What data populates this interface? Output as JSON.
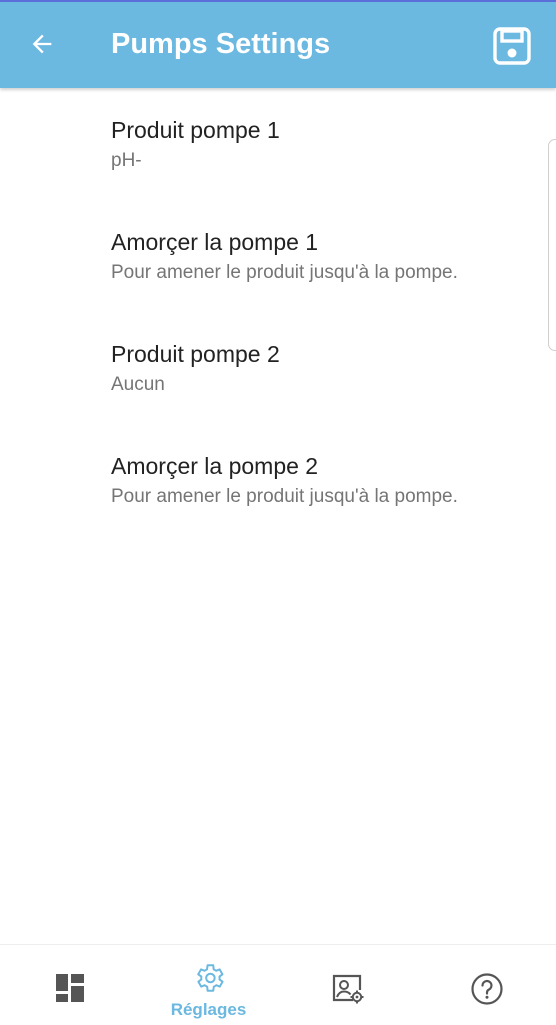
{
  "header": {
    "title": "Pumps Settings",
    "back_icon": "arrow-left-icon",
    "save_icon": "floppy-disk-icon",
    "background": "#6bb8e0"
  },
  "settings": [
    {
      "title": "Produit pompe 1",
      "subtitle": "pH-"
    },
    {
      "title": "Amorçer la pompe 1",
      "subtitle": "Pour amener le produit jusqu'à la pompe."
    },
    {
      "title": "Produit pompe 2",
      "subtitle": "Aucun"
    },
    {
      "title": "Amorçer la pompe 2",
      "subtitle": "Pour amener le produit jusqu'à la pompe."
    }
  ],
  "bottom_nav": {
    "active_color": "#6bb8e0",
    "inactive_color": "#555555",
    "items": [
      {
        "icon": "dashboard-icon",
        "label": "",
        "active": false
      },
      {
        "icon": "gear-icon",
        "label": "Réglages",
        "active": true
      },
      {
        "icon": "image-settings-icon",
        "label": "",
        "active": false
      },
      {
        "icon": "help-icon",
        "label": "",
        "active": false
      }
    ]
  }
}
